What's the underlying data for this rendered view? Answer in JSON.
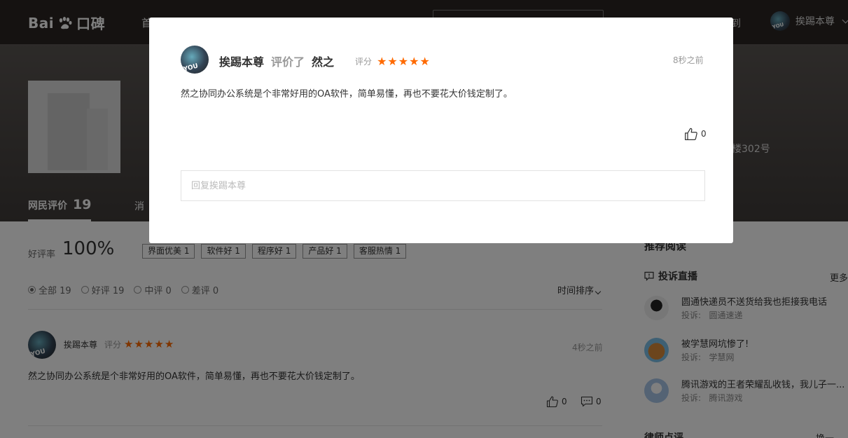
{
  "topbar": {
    "logo_text": "Bai",
    "logo_du": "du",
    "logo_suffix": "口碑",
    "nav_first": "首",
    "search_placeholder": "",
    "checkin": "到",
    "username": "挨踢本尊"
  },
  "hero": {
    "address_fragment": "楼302号",
    "tabs": [
      {
        "label": "网民评价",
        "count": "19"
      },
      {
        "label": "消"
      }
    ]
  },
  "summary": {
    "rate_label": "好评率",
    "rate_value": "100%",
    "tags": [
      "界面优美 1",
      "软件好 1",
      "程序好 1",
      "产品好 1",
      "客服热情 1"
    ]
  },
  "filters": [
    {
      "label": "全部 19",
      "selected": true
    },
    {
      "label": "好评 19",
      "selected": false
    },
    {
      "label": "中评 0",
      "selected": false
    },
    {
      "label": "差评 0",
      "selected": false
    }
  ],
  "sort_label": "时间排序",
  "review": {
    "user": "挨踢本尊",
    "score_label": "评分",
    "stars": 5,
    "time": "4秒之前",
    "text": "然之协同办公系统是个非常好用的OA软件，简单易懂，再也不要花大价钱定制了。",
    "likes": "0",
    "comments": "0"
  },
  "sidebar": {
    "title": "推荐阅读",
    "section": "投诉直播",
    "more": "更多",
    "items": [
      {
        "title": "圆通快递员不送货给我也拒接我电话",
        "prefix": "投诉:",
        "target": "圆通速递"
      },
      {
        "title": "被学慧网坑惨了!",
        "prefix": "投诉:",
        "target": "学慧网"
      },
      {
        "title": "腾讯游戏的王者荣耀乱收钱，我儿子一...",
        "prefix": "投诉:",
        "target": "腾讯游戏"
      }
    ],
    "bottom_left": "律师点评",
    "bottom_right": "换一"
  },
  "modal": {
    "user": "挨踢本尊",
    "verb": "评价了",
    "shop": "然之",
    "score_label": "评分",
    "stars": 5,
    "time": "8秒之前",
    "text": "然之协同办公系统是个非常好用的OA软件，简单易懂，再也不要花大价钱定制了。",
    "likes": "0",
    "reply_placeholder": "回复挨踢本尊"
  },
  "colors": {
    "star": "#ff6a00",
    "topbar": "#2b2522"
  }
}
